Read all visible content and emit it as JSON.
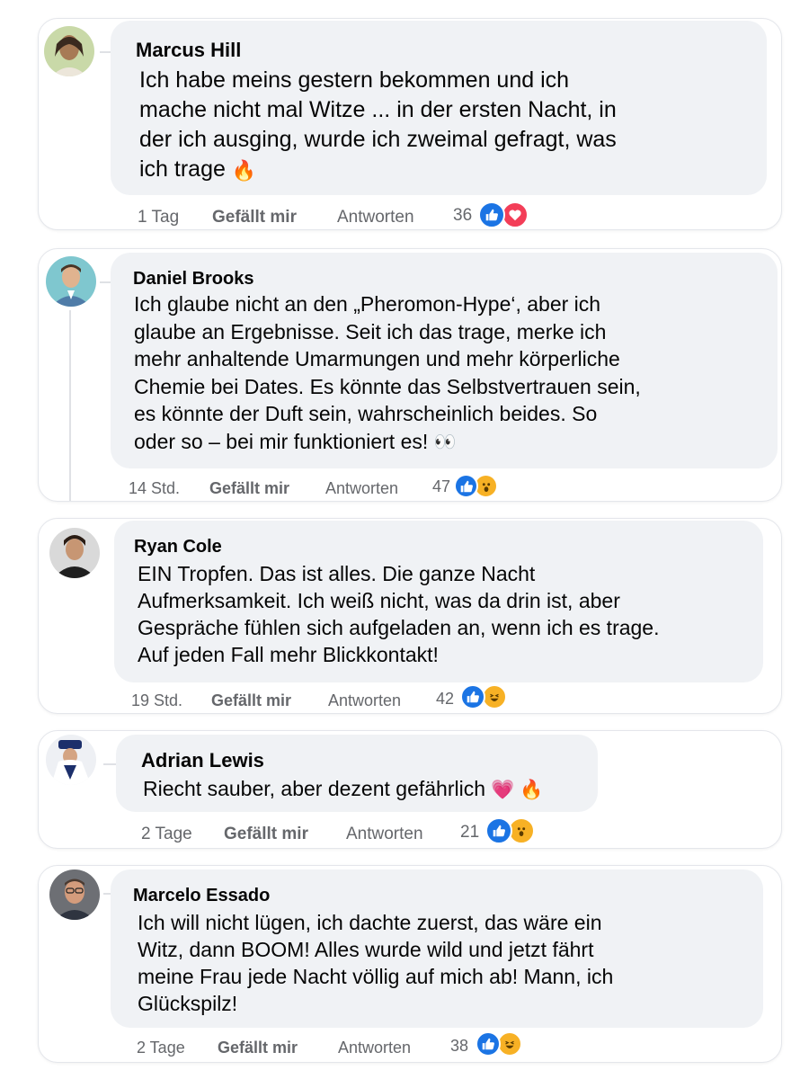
{
  "colors": {
    "like_blue": "#1b74e4",
    "love_red": "#f33e58",
    "reaction_yellow": "#f7b125",
    "bubble_bg": "#f0f2f5",
    "meta_grey": "#65676b"
  },
  "comments": [
    {
      "author": "Marcus Hill",
      "text": "Ich habe meins gestern bekommen und ich\nmache nicht mal Witze ... in der ersten Nacht, in\nder ich ausging, wurde ich zweimal gefragt, was\nich trage",
      "emoji": "🔥",
      "time": "1 Tag",
      "like_label": "Gefällt mir",
      "reply_label": "Antworten",
      "reaction_count": "36",
      "reactions": [
        "like-icon",
        "love-icon"
      ]
    },
    {
      "author": "Daniel Brooks",
      "text": "Ich glaube nicht an den „Pheromon-Hype‘, aber ich\nglaube an Ergebnisse. Seit ich das trage, merke ich\nmehr anhaltende Umarmungen und mehr körperliche\nChemie bei Dates. Es könnte das Selbstvertrauen sein,\nes könnte der Duft sein, wahrscheinlich beides. So\noder so – bei mir funktioniert es!",
      "emoji": "👀",
      "time": "14 Std.",
      "like_label": "Gefällt mir",
      "reply_label": "Antworten",
      "reaction_count": "47",
      "reactions": [
        "like-icon",
        "wow-icon"
      ]
    },
    {
      "author": "Ryan Cole",
      "text": "EIN Tropfen. Das ist alles. Die ganze Nacht\nAufmerksamkeit. Ich weiß nicht, was da drin ist, aber\nGespräche fühlen sich aufgeladen an, wenn ich es trage.\nAuf jeden Fall mehr Blickkontakt!",
      "emoji": "",
      "time": "19 Std.",
      "like_label": "Gefällt mir",
      "reply_label": "Antworten",
      "reaction_count": "42",
      "reactions": [
        "like-icon",
        "haha-icon"
      ]
    },
    {
      "author": "Adrian Lewis",
      "text": "Riecht sauber, aber dezent gefährlich",
      "emoji": "💗 🔥",
      "time": "2 Tage",
      "like_label": "Gefällt mir",
      "reply_label": "Antworten",
      "reaction_count": "21",
      "reactions": [
        "like-icon",
        "wow-icon"
      ]
    },
    {
      "author": "Marcelo Essado",
      "text": "Ich will nicht lügen, ich dachte zuerst, das wäre ein\nWitz, dann BOOM! Alles wurde wild und jetzt fährt\nmeine Frau jede Nacht völlig auf mich ab! Mann, ich\nGlückspilz!",
      "emoji": "",
      "time": "2 Tage",
      "like_label": "Gefällt mir",
      "reply_label": "Antworten",
      "reaction_count": "38",
      "reactions": [
        "like-icon",
        "haha-icon"
      ]
    }
  ]
}
